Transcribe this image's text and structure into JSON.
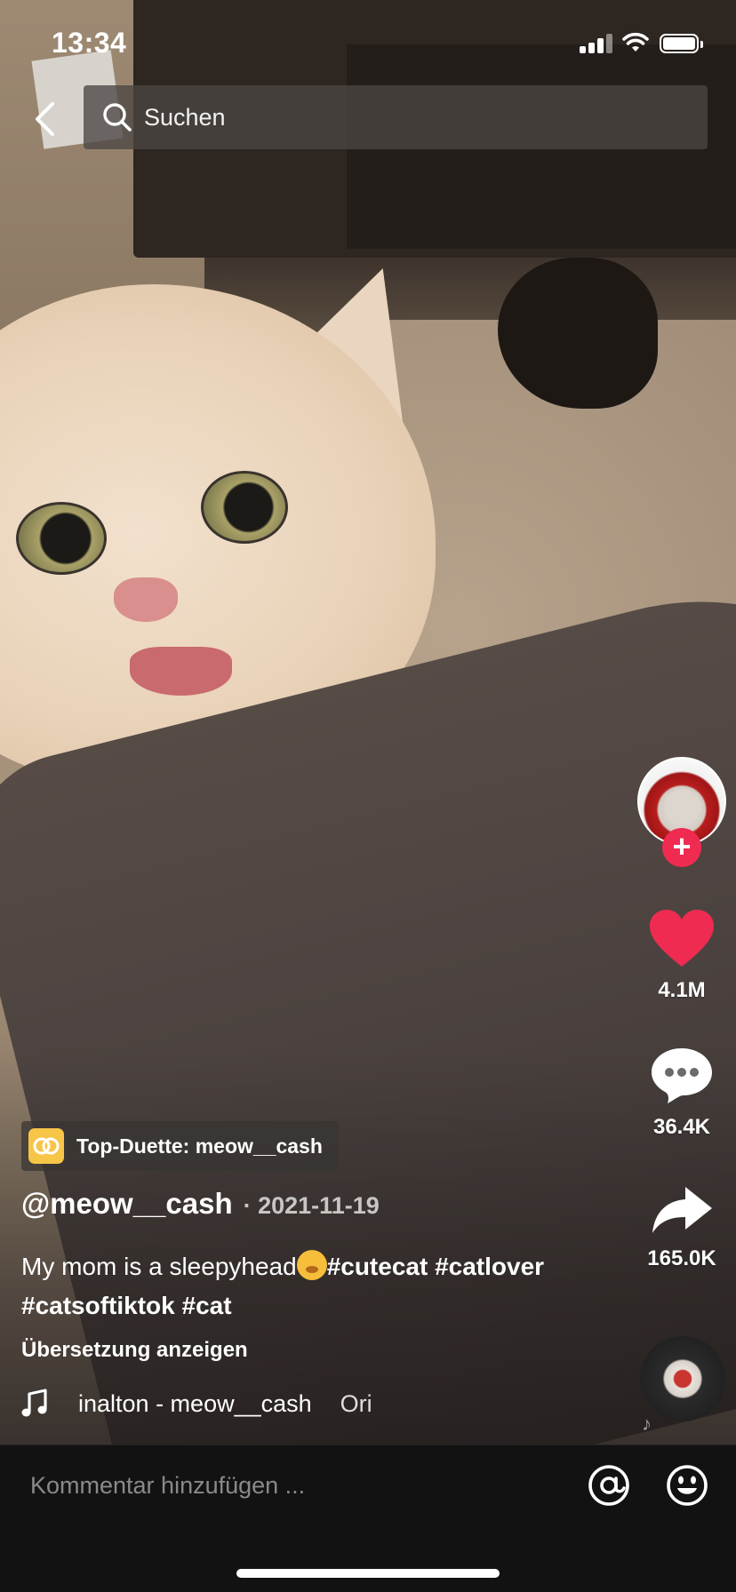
{
  "status_bar": {
    "time": "13:34"
  },
  "search": {
    "placeholder": "Suchen"
  },
  "rail": {
    "likes": "4.1M",
    "comments": "36.4K",
    "shares": "165.0K"
  },
  "post": {
    "duet_label": "Top-Duette: meow__cash",
    "author": "@meow__cash",
    "date": "· 2021-11-19",
    "caption_text": "My mom is a sleepyhead",
    "hashtags_line1": "#cutecat #catlover",
    "hashtags_line2": "#catsoftiktok #cat",
    "translate_label": "Übersetzung anzeigen",
    "music": "inalton - meow__cash",
    "music_next": "Ori"
  },
  "comment_bar": {
    "placeholder": "Kommentar hinzufügen ..."
  },
  "colors": {
    "like": "#ef2b51",
    "follow": "#ef2b51",
    "duet_badge": "#f7c548"
  },
  "icons": [
    "back-icon",
    "search-icon",
    "heart-icon",
    "comment-icon",
    "share-icon",
    "music-note-icon",
    "at-icon",
    "emoji-icon"
  ]
}
